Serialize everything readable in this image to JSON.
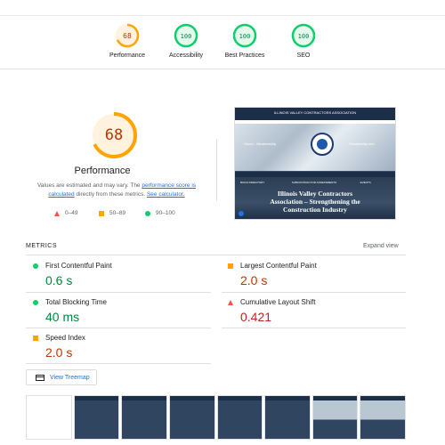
{
  "summary": {
    "gauges": [
      {
        "score": "68",
        "label": "Performance",
        "color": "#ffa400"
      },
      {
        "score": "100",
        "label": "Accessibility",
        "color": "#0cce6b"
      },
      {
        "score": "100",
        "label": "Best Practices",
        "color": "#0cce6b"
      },
      {
        "score": "100",
        "label": "SEO",
        "color": "#0cce6b"
      }
    ]
  },
  "performance": {
    "score": "68",
    "title": "Performance",
    "desc_part1": "Values are estimated and may vary. The ",
    "desc_link1": "performance score is calculated",
    "desc_part2": " directly from these metrics. ",
    "desc_link2": "See calculator.",
    "legend": [
      {
        "shape": "triangle",
        "range": "0–49",
        "color": "#ff4e42"
      },
      {
        "shape": "square",
        "range": "50–89",
        "color": "#ffa400"
      },
      {
        "shape": "circle",
        "range": "90–100",
        "color": "#0cce6b"
      }
    ]
  },
  "screenshot": {
    "site_name": "ILLINOIS VALLEY CONTRACTORS ASSOCIATION",
    "hero_left": "Home - Membership",
    "hero_right": "Scholarship Info",
    "nav_items": [
      "BUILD DIRECTORY",
      "SUBCONTRACTOR ASSESSMENTS",
      "EVENTS"
    ],
    "headline": "Illinois Valley Contractors Association – Strengthening the Construction Industry"
  },
  "metrics": {
    "heading": "METRICS",
    "expand_label": "Expand view",
    "items": [
      {
        "name": "First Contentful Paint",
        "value": "0.6 s",
        "status": "pass"
      },
      {
        "name": "Largest Contentful Paint",
        "value": "2.0 s",
        "status": "average"
      },
      {
        "name": "Total Blocking Time",
        "value": "40 ms",
        "status": "pass"
      },
      {
        "name": "Cumulative Layout Shift",
        "value": "0.421",
        "status": "fail"
      },
      {
        "name": "Speed Index",
        "value": "2.0 s",
        "status": "average"
      }
    ]
  },
  "treemap": {
    "label": "View Treemap",
    "icon": "treemap-icon"
  },
  "colors": {
    "pass": "#0cce6b",
    "average": "#ffa400",
    "fail": "#ff4e42",
    "link": "#1a73e8"
  }
}
